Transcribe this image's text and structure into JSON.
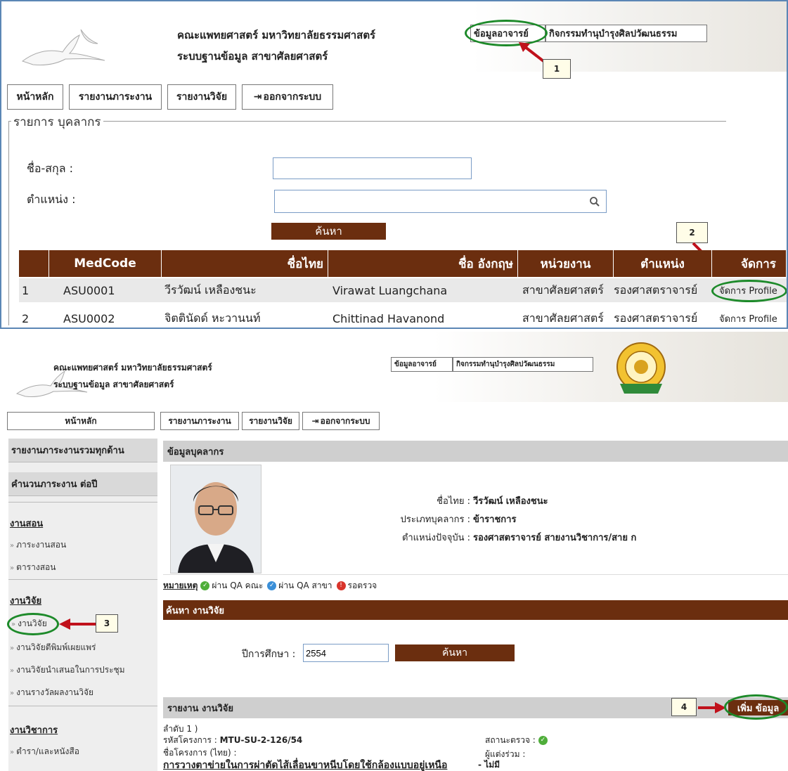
{
  "panel1": {
    "header": {
      "faculty": "คณะแพทยศาสตร์ มหาวิทยาลัยธรรมศาสตร์",
      "system": "ระบบฐานข้อมูล สาขาศัลยศาสตร์",
      "btn_teacher": "ข้อมูลอาจารย์",
      "btn_activity": "กิจกรรมทำนุบำรุงศิลปวัฒนธรรม"
    },
    "menu": {
      "home": "หน้าหลัก",
      "workload": "รายงานภาระงาน",
      "research": "รายงานวิจัย",
      "logout": "ออกจากระบบ"
    },
    "fieldset_legend": "รายการ บุคลากร",
    "form": {
      "name_label": "ชื่อ-สกุล :",
      "name_value": "",
      "position_label": "ตำแหน่ง :",
      "position_value": "",
      "search_button": "ค้นหา"
    },
    "table": {
      "headers": [
        "",
        "MedCode",
        "ชื่อไทย",
        "ชื่อ อังกฤษ",
        "หน่วยงาน",
        "ตำแหน่ง",
        "จัดการ"
      ],
      "rows": [
        [
          "1",
          "ASU0001",
          "วีรวัฒน์ เหลืองชนะ",
          "Virawat Luangchana",
          "สาขาศัลยศาสตร์",
          "รองศาสตราจารย์",
          "จัดการ Profile"
        ],
        [
          "2",
          "ASU0002",
          "จิตตินัดด์ หะวานนท์",
          "Chittinad Havanond",
          "สาขาศัลยศาสตร์",
          "รองศาสตราจารย์",
          "จัดการ Profile"
        ]
      ]
    },
    "callouts": [
      "1",
      "2"
    ]
  },
  "panel2": {
    "header": {
      "faculty": "คณะแพทยศาสตร์ มหาวิทยาลัยธรรมศาสตร์",
      "system": "ระบบฐานข้อมูล สาขาศัลยศาสตร์",
      "btn_teacher": "ข้อมูลอาจารย์",
      "btn_activity": "กิจกรรมทำนุบำรุงศิลปวัฒนธรรม"
    },
    "menu": {
      "home": "หน้าหลัก",
      "workload": "รายงานภาระงาน",
      "research": "รายงานวิจัย",
      "logout": "ออกจากระบบ"
    },
    "sidebar": {
      "all_report": "รายงานภาระงานรวมทุกด้าน",
      "count_year": "คำนวนภาระงาน ต่อปี",
      "teaching": "งานสอน",
      "teaching_items": [
        "ภาระงานสอน",
        "ตารางสอน"
      ],
      "research": "งานวิจัย",
      "research_items": [
        "งานวิจัย",
        "งานวิจัยตีพิมพ์เผยแพร่",
        "งานวิจัยนำเสนอในการประชุม",
        "งานรางวัลผลงานวิจัย"
      ],
      "academic": "งานวิชาการ",
      "academic_items": [
        "ตำรา/และหนังสือ"
      ]
    },
    "profile": {
      "section_title": "ข้อมูลบุคลากร",
      "name_label": "ชื่อไทย :",
      "name_value": "วีรวัฒน์ เหลืองชนะ",
      "type_label": "ประเภทบุคลากร :",
      "type_value": "ข้าราชการ",
      "pos_label": "ตำแหน่งปัจจุบัน :",
      "pos_value": "รองศาสตราจารย์ สายงานวิชาการ/สาย ก"
    },
    "legend": {
      "title": "หมายเหตุ",
      "qa_faculty": "ผ่าน QA คณะ",
      "qa_dept": "ผ่าน QA สาขา",
      "pending": "รอตรวจ"
    },
    "search": {
      "title": "ค้นหา งานวิจัย",
      "year_label": "ปีการศึกษา :",
      "year_value": "2554",
      "button": "ค้นหา"
    },
    "report": {
      "title": "รายงาน งานวิจัย",
      "add_button": "เพิ่ม ข้อมูล",
      "item_no": "ลำดับ 1 )",
      "code_label": "รหัสโครงการ :",
      "code_value": "MTU-SU-2-126/54",
      "status_label": "สถานะตรวจ :",
      "name_th_label": "ชื่อโครงการ (ไทย) :",
      "coauthor_label": "ผู้แต่งร่วม :",
      "name_th_value": "การวางตาข่ายในการผ่าตัดไส้เลื่อนขาหนีบโดยใช้กล้องแบบอยู่เหนือ",
      "coauthor_value": "- ไม่มี"
    },
    "callouts": [
      "3",
      "4"
    ]
  },
  "colors": {
    "brown": "#6b2e0f",
    "green_oval": "#1d8a2a",
    "red_arrow": "#c0111b",
    "panel_border": "#5b86b5"
  }
}
